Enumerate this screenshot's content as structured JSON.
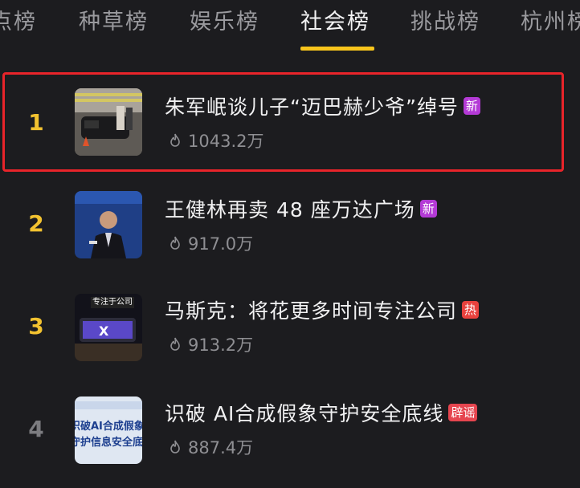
{
  "tabs": [
    {
      "label": "点榜"
    },
    {
      "label": "种草榜"
    },
    {
      "label": "娱乐榜"
    },
    {
      "label": "社会榜"
    },
    {
      "label": "挑战榜"
    },
    {
      "label": "杭州榜"
    }
  ],
  "active_tab": "社会榜",
  "colors": {
    "accent": "#f8c51c",
    "rank_top": "#f2c230",
    "rank_other": "#7c7c80",
    "badge_new": "#b43ad6",
    "badge_hot": "#e8413d",
    "badge_rumor": "#e6454f",
    "highlight": "#e8242a"
  },
  "items": [
    {
      "rank": "1",
      "title": "朱军岷谈儿子“迈巴赫少爷”绰号",
      "badge": "新",
      "heat": "1043.2万"
    },
    {
      "rank": "2",
      "title": "王健林再卖 48 座万达广场",
      "badge": "新",
      "heat": "917.0万"
    },
    {
      "rank": "3",
      "title": "马斯克：将花更多时间专注公司",
      "badge": "热",
      "heat": "913.2万"
    },
    {
      "rank": "4",
      "title": "识破 AI合成假象守护安全底线",
      "badge": "辟谣",
      "heat": "887.4万"
    }
  ],
  "thumbs": {
    "item1_caption": "",
    "item3_caption": "专注于公司",
    "item4_line1": "识破AI合成假象",
    "item4_line2": "守护信息安全底线"
  }
}
